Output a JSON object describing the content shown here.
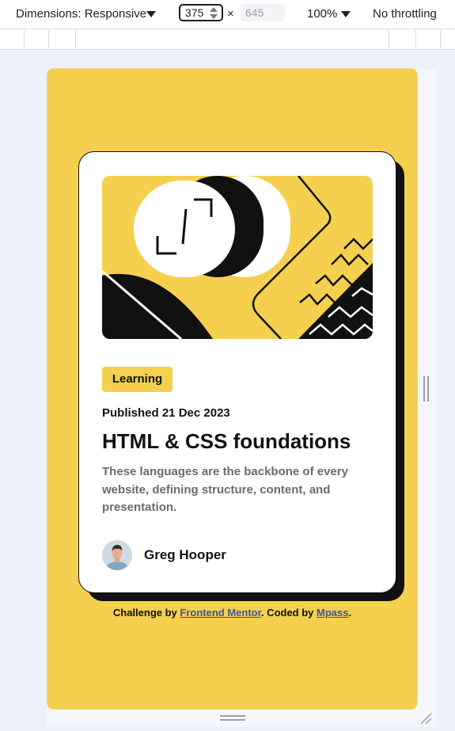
{
  "devtools": {
    "dimensions_label": "Dimensions: Responsive",
    "width_value": "375",
    "times": "×",
    "height_placeholder": "645",
    "zoom": "100%",
    "throttling": "No throttling"
  },
  "card": {
    "tag": "Learning",
    "published": "Published 21 Dec 2023",
    "title": "HTML & CSS foundations",
    "description": "These languages are the backbone of every website, defining structure, content, and presentation.",
    "author": "Greg Hooper"
  },
  "attribution": {
    "prefix": "Challenge by ",
    "frontend_mentor": "Frontend Mentor",
    "middle": ". Coded by ",
    "author": "Mpass",
    "suffix": "."
  },
  "colors": {
    "accent": "#f4d04e",
    "ink": "#111111",
    "link": "#3e52a3"
  }
}
